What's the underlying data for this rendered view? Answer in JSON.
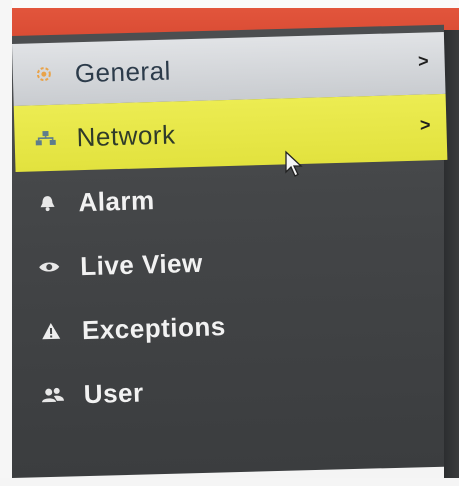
{
  "menu": {
    "items": [
      {
        "label": "General",
        "icon": "gear-icon",
        "chevron": ">",
        "state": "normal"
      },
      {
        "label": "Network",
        "icon": "network-icon",
        "chevron": ">",
        "state": "selected"
      },
      {
        "label": "Alarm",
        "icon": "bell-icon",
        "state": "normal"
      },
      {
        "label": "Live View",
        "icon": "eye-icon",
        "state": "normal"
      },
      {
        "label": "Exceptions",
        "icon": "warning-icon",
        "state": "normal"
      },
      {
        "label": "User",
        "icon": "users-icon",
        "state": "normal"
      }
    ]
  },
  "colors": {
    "header_red": "#dd4f36",
    "selected_yellow": "#e6e648",
    "general_gray": "#d3d6d9",
    "panel_dark": "#434547"
  }
}
